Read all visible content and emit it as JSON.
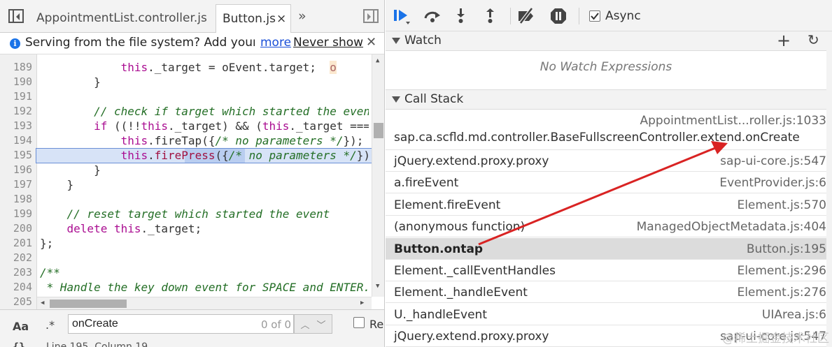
{
  "sources_panel": {
    "tabs": [
      {
        "label": "AppointmentList.controller.js"
      },
      {
        "label": "Button.js",
        "close": "×"
      }
    ],
    "tabs_more": "»",
    "infobar": {
      "text": "Serving from the file system? Add your files into the workspace.",
      "more_link": "more",
      "never_show_link": "Never show",
      "close": "✕"
    },
    "code_lines": [
      {
        "num": "189",
        "html": "            <span class=\"kw\">this</span>._target = oEvent.target;  <span style=\"background:#fbe8cf;color:#a66\">o</span>"
      },
      {
        "num": "190",
        "html": "        }"
      },
      {
        "num": "191",
        "html": ""
      },
      {
        "num": "192",
        "html": "        <span class=\"cm\">// check if target which started the event is the same</span>"
      },
      {
        "num": "193",
        "html": "        <span class=\"kw\">if</span> ((!!<span class=\"kw\">this</span>._target) &amp;&amp; (<span class=\"kw\">this</span>._target === oEvent.target)) {"
      },
      {
        "num": "194",
        "html": "            <span class=\"kw\">this</span>.fireTap({<span class=\"cm\">/* no parameters */</span>});"
      },
      {
        "num": "195",
        "html": "            <span class=\"kw\">this</span>.<span class=\"hw\">firePress</span>({<span class=\"cm\">/* no parameters */</span>});"
      },
      {
        "num": "196",
        "html": "        }"
      },
      {
        "num": "197",
        "html": "    }"
      },
      {
        "num": "198",
        "html": ""
      },
      {
        "num": "199",
        "html": "    <span class=\"cm\">// reset target which started the event</span>"
      },
      {
        "num": "200",
        "html": "    <span class=\"kw\">delete</span> <span class=\"kw\">this</span>._target;"
      },
      {
        "num": "201",
        "html": "};"
      },
      {
        "num": "202",
        "html": ""
      },
      {
        "num": "203",
        "html": "<span class=\"cm\">/**</span>"
      },
      {
        "num": "204",
        "html": "<span class=\"cm\"> * Handle the key down event for SPACE and ENTER.</span>"
      },
      {
        "num": "205",
        "html": ""
      }
    ],
    "search": {
      "case_toggle": "Aa",
      "regex_toggle": ".*",
      "query": "onCreate",
      "match_count": "0 of 0",
      "prev": "︿",
      "next": "﹀",
      "regex_checkbox_label": "Re"
    },
    "status": {
      "braces": "{}",
      "position": "Line 195, Column 19"
    }
  },
  "debugger_panel": {
    "toolbar_icons": [
      "resume-icon",
      "step-over-icon",
      "step-into-icon",
      "step-out-icon",
      "deactivate-breakpoints-icon",
      "pause-on-exceptions-icon"
    ],
    "async_label": "Async",
    "async_checked": true,
    "watch": {
      "title": "Watch",
      "add": "+",
      "refresh": "↻",
      "empty_text": "No Watch Expressions"
    },
    "call_stack": {
      "title": "Call Stack",
      "frames": [
        {
          "fn": "sap.ca.scfld.md.controller.BaseFullscreenController.extend.onCreate",
          "loc": "AppointmentList...roller.js:1033"
        },
        {
          "fn": "jQuery.extend.proxy.proxy",
          "loc": "sap-ui-core.js:547"
        },
        {
          "fn": "a.fireEvent",
          "loc": "EventProvider.js:6"
        },
        {
          "fn": "Element.fireEvent",
          "loc": "Element.js:570"
        },
        {
          "fn": "(anonymous function)",
          "loc": "ManagedObjectMetadata.js:404"
        },
        {
          "fn": "Button.ontap",
          "loc": "Button.js:195",
          "selected": true
        },
        {
          "fn": "Element._callEventHandles",
          "loc": "Element.js:296"
        },
        {
          "fn": "Element._handleEvent",
          "loc": "Element.js:276"
        },
        {
          "fn": "U._handleEvent",
          "loc": "UIArea.js:6"
        },
        {
          "fn": "jQuery.extend.proxy.proxy",
          "loc": "sap-ui-core.js:547"
        }
      ]
    }
  },
  "watermark": "@稀土掘金技术社区",
  "colors": {
    "accent": "#1a73e8",
    "annotation_arrow": "#d92323",
    "selected_row": "#dcdcdc"
  }
}
